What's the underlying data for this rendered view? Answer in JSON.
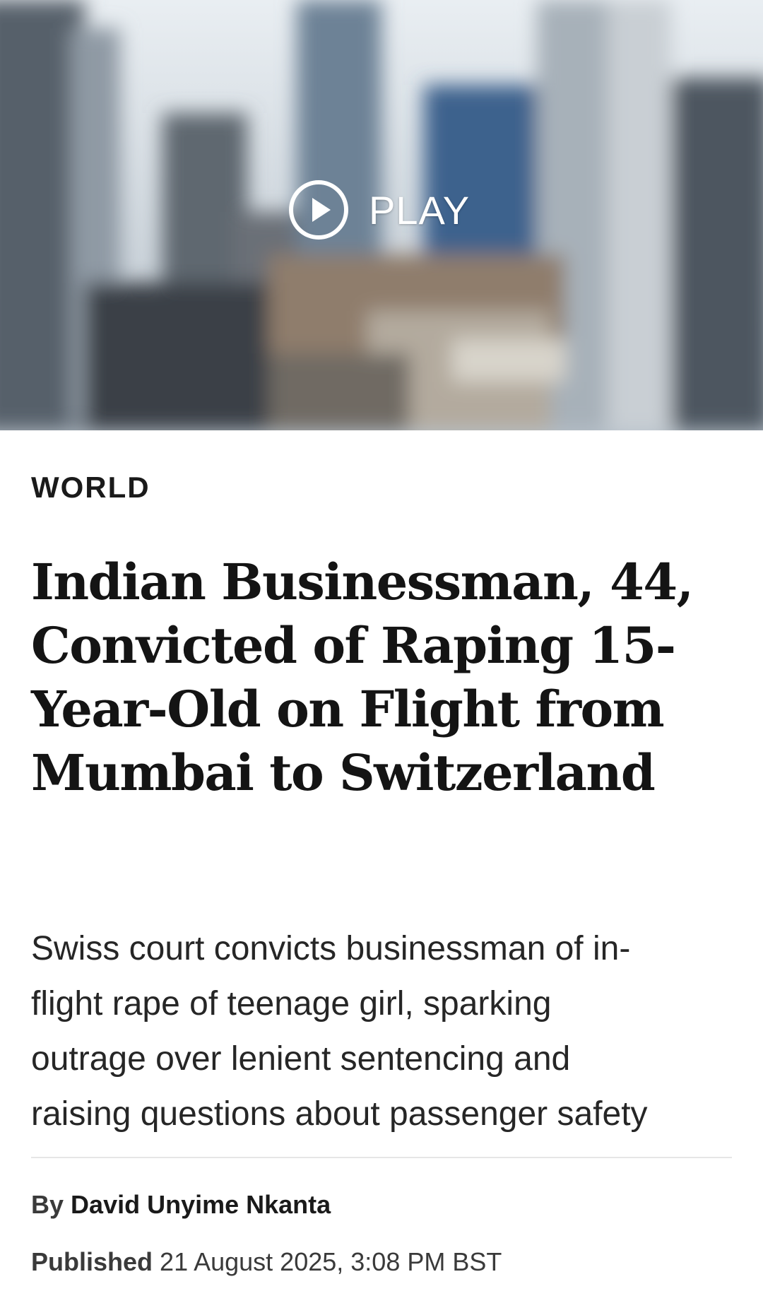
{
  "hero": {
    "play_label": "PLAY",
    "icon": "play-circle-icon",
    "colors": {
      "sky": "#c9d2da",
      "building_dark": "#4d5760",
      "building_mid": "#7f8a94",
      "building_blue": "#3f6590",
      "ground_warm": "#8f7d6c"
    }
  },
  "article": {
    "section": "WORLD",
    "headline_lines": [
      "Indian Businessman, 44,",
      "Convicted of Raping 15-",
      "Year-Old on Flight from",
      "Mumbai to Switzerland"
    ],
    "dek_lines": [
      "Swiss court convicts businessman of in-",
      "flight rape of teenage girl, sparking",
      "outrage over lenient sentencing and",
      "raising questions about passenger safety"
    ],
    "byline_label": "By",
    "author": "David Unyime Nkanta",
    "published_label": "Published",
    "published_date": "21 August 2025, 3:08 PM BST"
  }
}
